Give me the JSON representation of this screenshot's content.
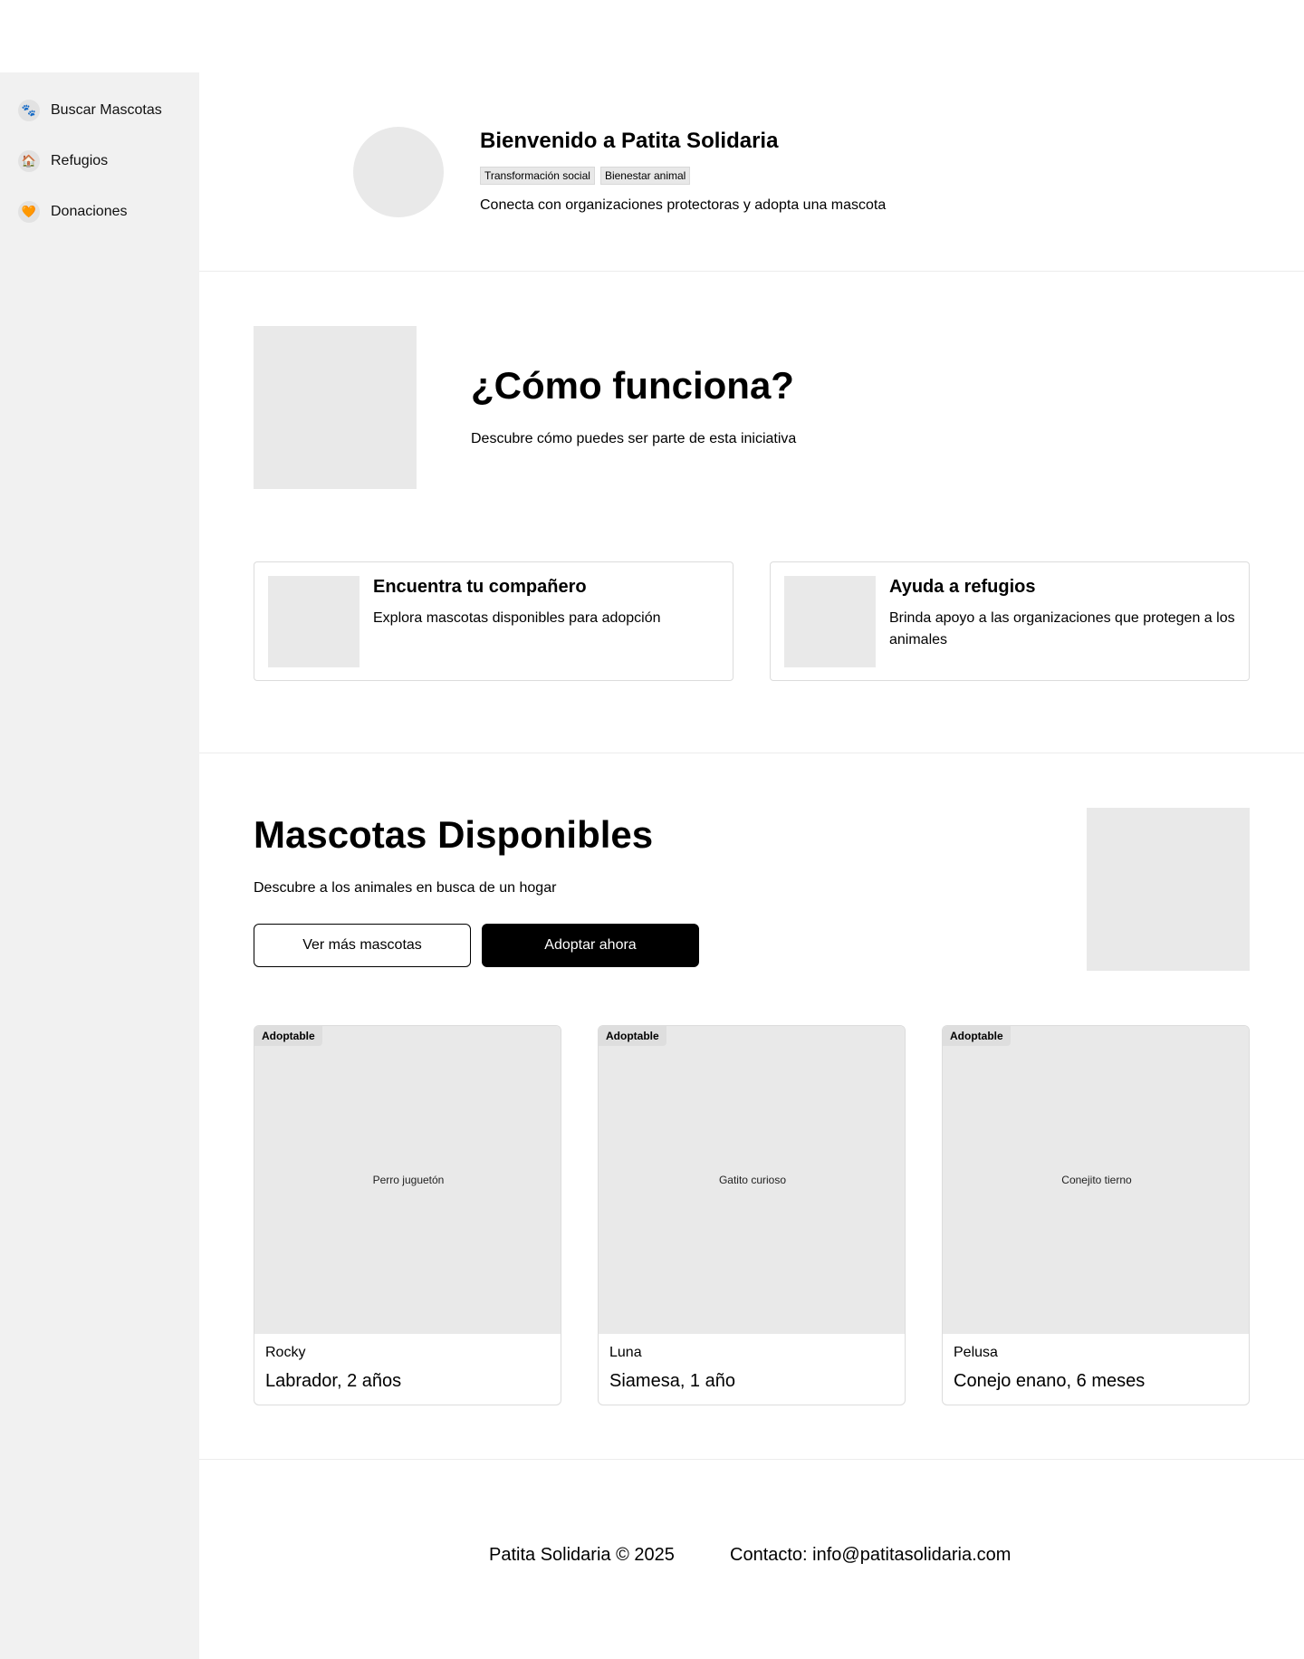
{
  "sidebar": {
    "items": [
      {
        "icon": "paw-icon",
        "glyph": "🐾",
        "label": "Buscar Mascotas"
      },
      {
        "icon": "house-icon",
        "glyph": "🏠",
        "label": "Refugios"
      },
      {
        "icon": "heart-icon",
        "glyph": "🧡",
        "label": "Donaciones"
      }
    ]
  },
  "welcome": {
    "title": "Bienvenido a Patita Solidaria",
    "tags": [
      "Transformación social",
      "Bienestar animal"
    ],
    "description": "Conecta con organizaciones protectoras y adopta una mascota"
  },
  "how": {
    "title": "¿Cómo funciona?",
    "description": "Descubre cómo puedes ser parte de esta iniciativa",
    "features": [
      {
        "title": "Encuentra tu compañero",
        "description": "Explora mascotas disponibles para adopción"
      },
      {
        "title": "Ayuda a refugios",
        "description": "Brinda apoyo a las organizaciones que protegen a los animales"
      }
    ]
  },
  "pets": {
    "title": "Mascotas Disponibles",
    "description": "Descubre a los animales en busca de un hogar",
    "buttons": {
      "more": "Ver más mascotas",
      "adopt": "Adoptar ahora"
    },
    "cards": [
      {
        "badge": "Adoptable",
        "photo_label": "Perro juguetón",
        "name": "Rocky",
        "breed": "Labrador, 2 años"
      },
      {
        "badge": "Adoptable",
        "photo_label": "Gatito curioso",
        "name": "Luna",
        "breed": "Siamesa, 1 año"
      },
      {
        "badge": "Adoptable",
        "photo_label": "Conejito tierno",
        "name": "Pelusa",
        "breed": "Conejo enano, 6 meses"
      }
    ]
  },
  "footer": {
    "copyright": "Patita Solidaria © 2025",
    "contact": "Contacto: info@patitasolidaria.com"
  },
  "colors": {
    "sidebar_bg": "#f1f1f1",
    "placeholder": "#e9e9e9",
    "primary_button": "#000000"
  }
}
